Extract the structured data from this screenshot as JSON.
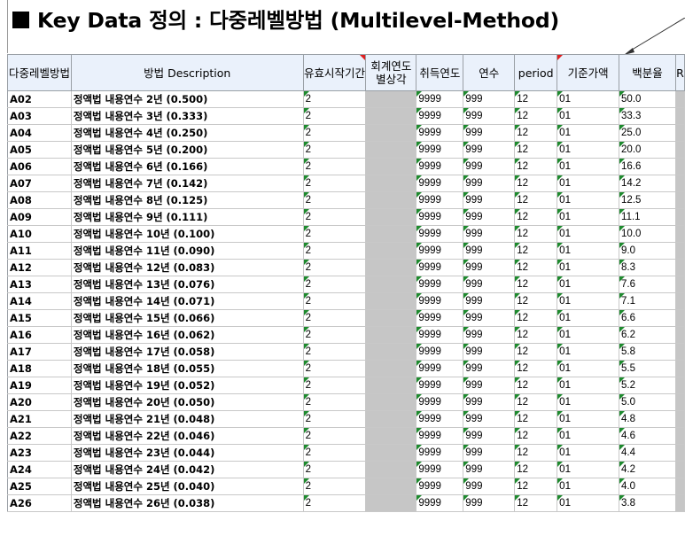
{
  "title": "Key Data 정의 : 다중레벨방법 (Multilevel-Method)",
  "headers": [
    "다중레벨방법",
    "방법 Description",
    "유효시작기간",
    "회계연도별상각",
    "취득연도",
    "연수",
    "period",
    "기준가액",
    "백분율",
    "R"
  ],
  "colors": {
    "header_bg": "#eaf1fb",
    "gray_cell": "#c6c6c6",
    "marker_green": "#1e8a2e",
    "marker_red": "#e02020"
  },
  "rows": [
    {
      "code": "A02",
      "desc": "정액법 내용연수 2년 (0.500)",
      "start": "2",
      "acq": "9999",
      "years": "999",
      "period": "12",
      "base": "01",
      "pct": "50.0"
    },
    {
      "code": "A03",
      "desc": "정액법 내용연수 3년 (0.333)",
      "start": "2",
      "acq": "9999",
      "years": "999",
      "period": "12",
      "base": "01",
      "pct": "33.3"
    },
    {
      "code": "A04",
      "desc": "정액법 내용연수 4년 (0.250)",
      "start": "2",
      "acq": "9999",
      "years": "999",
      "period": "12",
      "base": "01",
      "pct": "25.0"
    },
    {
      "code": "A05",
      "desc": "정액법 내용연수 5년 (0.200)",
      "start": "2",
      "acq": "9999",
      "years": "999",
      "period": "12",
      "base": "01",
      "pct": "20.0"
    },
    {
      "code": "A06",
      "desc": "정액법 내용연수 6년 (0.166)",
      "start": "2",
      "acq": "9999",
      "years": "999",
      "period": "12",
      "base": "01",
      "pct": "16.6"
    },
    {
      "code": "A07",
      "desc": "정액법 내용연수 7년 (0.142)",
      "start": "2",
      "acq": "9999",
      "years": "999",
      "period": "12",
      "base": "01",
      "pct": "14.2"
    },
    {
      "code": "A08",
      "desc": "정액법 내용연수 8년 (0.125)",
      "start": "2",
      "acq": "9999",
      "years": "999",
      "period": "12",
      "base": "01",
      "pct": "12.5"
    },
    {
      "code": "A09",
      "desc": "정액법 내용연수 9년 (0.111)",
      "start": "2",
      "acq": "9999",
      "years": "999",
      "period": "12",
      "base": "01",
      "pct": "11.1"
    },
    {
      "code": "A10",
      "desc": "정액법 내용연수 10년 (0.100)",
      "start": "2",
      "acq": "9999",
      "years": "999",
      "period": "12",
      "base": "01",
      "pct": "10.0"
    },
    {
      "code": "A11",
      "desc": "정액법 내용연수 11년 (0.090)",
      "start": "2",
      "acq": "9999",
      "years": "999",
      "period": "12",
      "base": "01",
      "pct": "9.0"
    },
    {
      "code": "A12",
      "desc": "정액법 내용연수 12년 (0.083)",
      "start": "2",
      "acq": "9999",
      "years": "999",
      "period": "12",
      "base": "01",
      "pct": "8.3"
    },
    {
      "code": "A13",
      "desc": "정액법 내용연수 13년 (0.076)",
      "start": "2",
      "acq": "9999",
      "years": "999",
      "period": "12",
      "base": "01",
      "pct": "7.6"
    },
    {
      "code": "A14",
      "desc": "정액법 내용연수 14년 (0.071)",
      "start": "2",
      "acq": "9999",
      "years": "999",
      "period": "12",
      "base": "01",
      "pct": "7.1"
    },
    {
      "code": "A15",
      "desc": "정액법 내용연수 15년 (0.066)",
      "start": "2",
      "acq": "9999",
      "years": "999",
      "period": "12",
      "base": "01",
      "pct": "6.6"
    },
    {
      "code": "A16",
      "desc": "정액법 내용연수 16년 (0.062)",
      "start": "2",
      "acq": "9999",
      "years": "999",
      "period": "12",
      "base": "01",
      "pct": "6.2"
    },
    {
      "code": "A17",
      "desc": "정액법 내용연수 17년 (0.058)",
      "start": "2",
      "acq": "9999",
      "years": "999",
      "period": "12",
      "base": "01",
      "pct": "5.8"
    },
    {
      "code": "A18",
      "desc": "정액법 내용연수 18년 (0.055)",
      "start": "2",
      "acq": "9999",
      "years": "999",
      "period": "12",
      "base": "01",
      "pct": "5.5"
    },
    {
      "code": "A19",
      "desc": "정액법 내용연수 19년 (0.052)",
      "start": "2",
      "acq": "9999",
      "years": "999",
      "period": "12",
      "base": "01",
      "pct": "5.2"
    },
    {
      "code": "A20",
      "desc": "정액법 내용연수 20년 (0.050)",
      "start": "2",
      "acq": "9999",
      "years": "999",
      "period": "12",
      "base": "01",
      "pct": "5.0"
    },
    {
      "code": "A21",
      "desc": "정액법 내용연수 21년 (0.048)",
      "start": "2",
      "acq": "9999",
      "years": "999",
      "period": "12",
      "base": "01",
      "pct": "4.8"
    },
    {
      "code": "A22",
      "desc": "정액법 내용연수 22년 (0.046)",
      "start": "2",
      "acq": "9999",
      "years": "999",
      "period": "12",
      "base": "01",
      "pct": "4.6"
    },
    {
      "code": "A23",
      "desc": "정액법 내용연수 23년 (0.044)",
      "start": "2",
      "acq": "9999",
      "years": "999",
      "period": "12",
      "base": "01",
      "pct": "4.4"
    },
    {
      "code": "A24",
      "desc": "정액법 내용연수 24년 (0.042)",
      "start": "2",
      "acq": "9999",
      "years": "999",
      "period": "12",
      "base": "01",
      "pct": "4.2"
    },
    {
      "code": "A25",
      "desc": "정액법 내용연수 25년 (0.040)",
      "start": "2",
      "acq": "9999",
      "years": "999",
      "period": "12",
      "base": "01",
      "pct": "4.0"
    },
    {
      "code": "A26",
      "desc": "정액법 내용연수 26년 (0.038)",
      "start": "2",
      "acq": "9999",
      "years": "999",
      "period": "12",
      "base": "01",
      "pct": "3.8"
    }
  ]
}
